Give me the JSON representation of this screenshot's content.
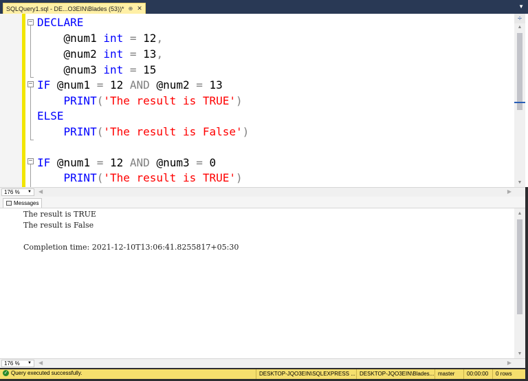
{
  "tab": {
    "title": "SQLQuery1.sql - DE...O3EIN\\Blades (53))*",
    "pin": "⊕",
    "close": "✕"
  },
  "editor": {
    "lines": {
      "l1": {
        "kw": "DECLARE"
      },
      "l2": {
        "var": "@num1",
        "type": "int",
        "eq": "=",
        "val": "12",
        "comma": ","
      },
      "l3": {
        "var": "@num2",
        "type": "int",
        "eq": "=",
        "val": "13",
        "comma": ","
      },
      "l4": {
        "var": "@num3",
        "type": "int",
        "eq": "=",
        "val": "15"
      },
      "l5": {
        "kw": "IF",
        "a": "@num1",
        "eq1": "=",
        "v1": "12",
        "and": "AND",
        "b": "@num2",
        "eq2": "=",
        "v2": "13"
      },
      "l6": {
        "fn": "PRINT",
        "open": "(",
        "str": "'The result is TRUE'",
        "close": ")"
      },
      "l7": {
        "kw": "ELSE"
      },
      "l8": {
        "fn": "PRINT",
        "open": "(",
        "str": "'The result is False'",
        "close": ")"
      },
      "l9": {
        "kw": "IF",
        "a": "@num1",
        "eq1": "=",
        "v1": "12",
        "and": "AND",
        "b": "@num3",
        "eq2": "=",
        "v2": "0"
      },
      "l10": {
        "fn": "PRINT",
        "open": "(",
        "str": "'The result is TRUE'",
        "close": ")"
      }
    },
    "zoom": "176 %"
  },
  "results": {
    "tab_label": "Messages",
    "lines": [
      "The result is TRUE",
      "The result is False",
      "",
      "Completion time: 2021-12-10T13:06:41.8255817+05:30"
    ],
    "zoom": "176 %"
  },
  "status": {
    "message": "Query executed successfully.",
    "server": "DESKTOP-JQO3EIN\\SQLEXPRESS ...",
    "user": "DESKTOP-JQO3EIN\\Blades...",
    "database": "master",
    "elapsed": "00:00:00",
    "rows": "0 rows"
  },
  "icons": [
    "pin-icon",
    "close-icon",
    "dropdown-icon",
    "split-icon",
    "fold-icon",
    "messages-icon",
    "success-icon"
  ]
}
